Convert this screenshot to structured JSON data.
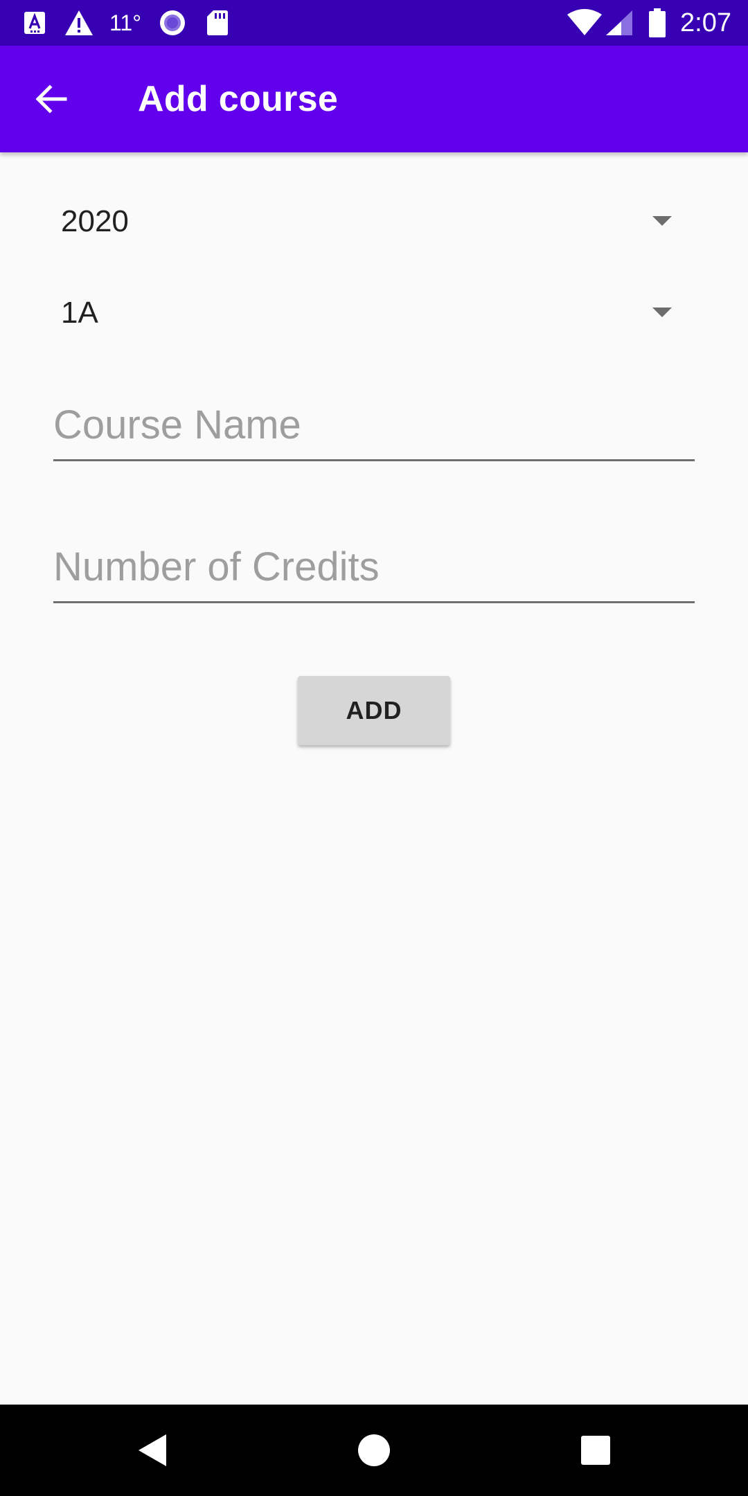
{
  "status_bar": {
    "temperature": "11°",
    "time": "2:07",
    "icons": [
      "accessibility-a-icon",
      "warning-icon",
      "media-record-icon",
      "sd-card-icon",
      "wifi-icon",
      "cellular-signal-icon",
      "battery-icon"
    ]
  },
  "app_bar": {
    "title": "Add course",
    "back_icon": "arrow-back-icon"
  },
  "form": {
    "year_spinner": {
      "value": "2020"
    },
    "term_spinner": {
      "value": "1A"
    },
    "course_name": {
      "placeholder": "Course Name",
      "value": ""
    },
    "credits": {
      "placeholder": "Number of Credits",
      "value": ""
    },
    "add_button": {
      "label": "ADD"
    }
  },
  "nav_bar": {
    "icons": [
      "nav-back-icon",
      "nav-home-icon",
      "nav-recents-icon"
    ]
  },
  "colors": {
    "status_bar": "#3700b3",
    "app_bar": "#6200ee",
    "background": "#fafafa",
    "button": "#d6d6d6"
  }
}
